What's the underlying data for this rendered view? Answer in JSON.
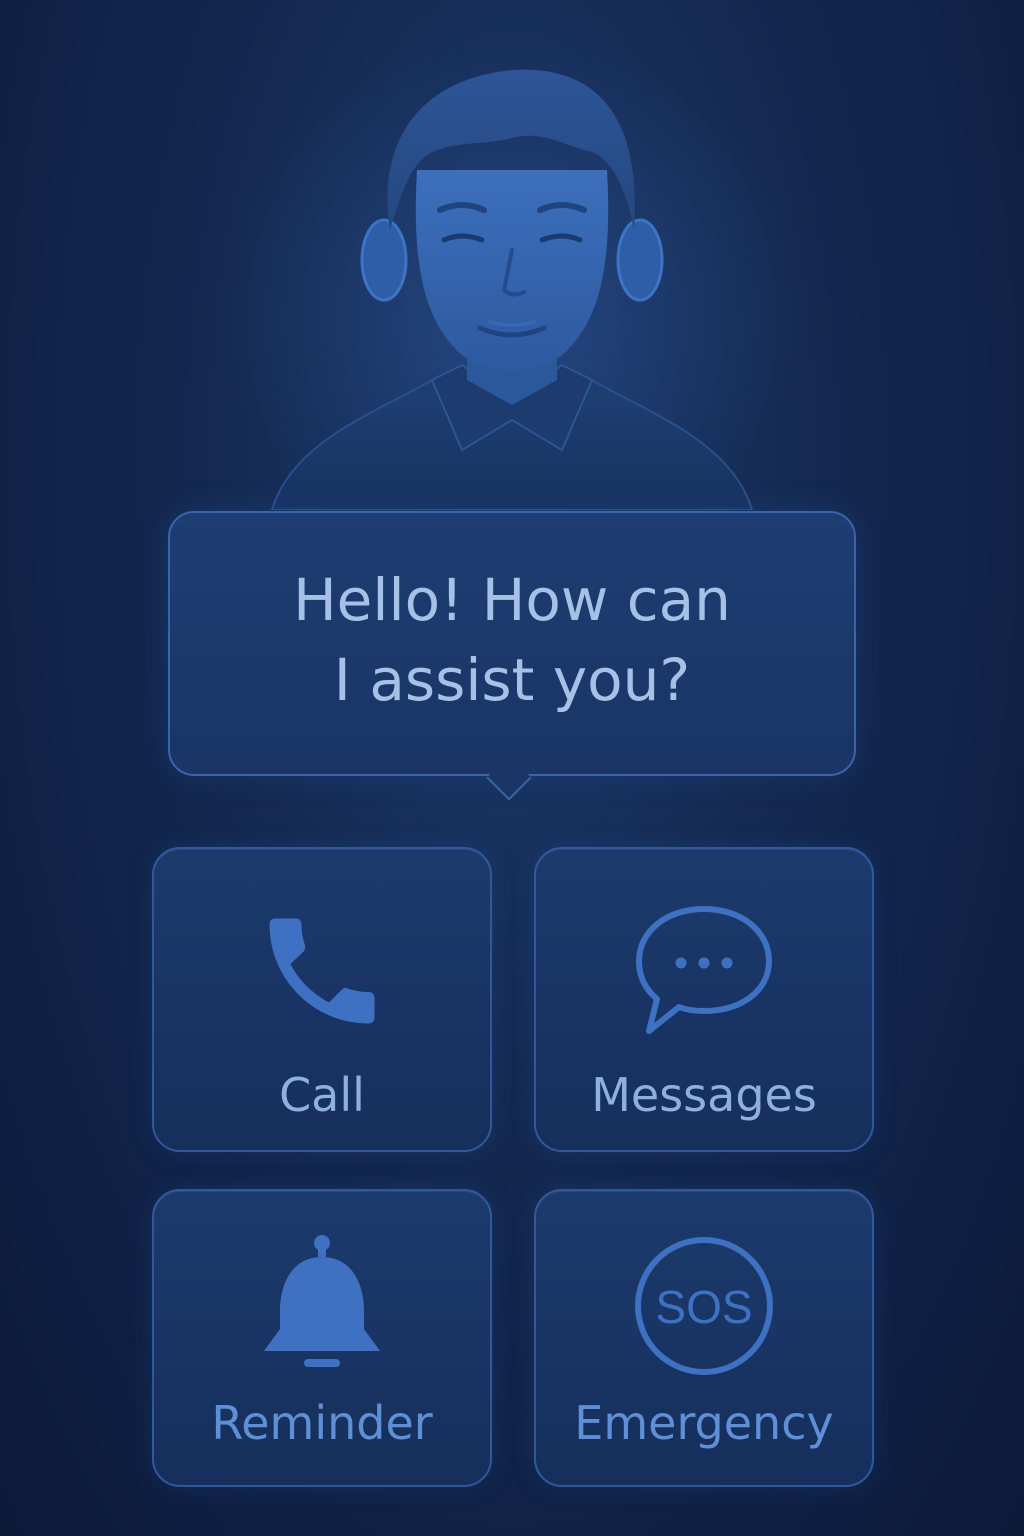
{
  "assistant": {
    "avatar_icon": "assistant-avatar-icon",
    "greeting": "Hello! How can\nI assist you?"
  },
  "actions": [
    {
      "id": "call",
      "label": "Call",
      "icon": "phone-icon"
    },
    {
      "id": "messages",
      "label": "Messages",
      "icon": "chat-bubble-icon"
    },
    {
      "id": "reminder",
      "label": "Reminder",
      "icon": "bell-icon"
    },
    {
      "id": "emergency",
      "label": "Emergency",
      "icon": "sos-icon",
      "icon_text": "SOS"
    }
  ],
  "colors": {
    "background": "#12264c",
    "accent": "#4a7dcc",
    "text": "#a7c1e6"
  }
}
